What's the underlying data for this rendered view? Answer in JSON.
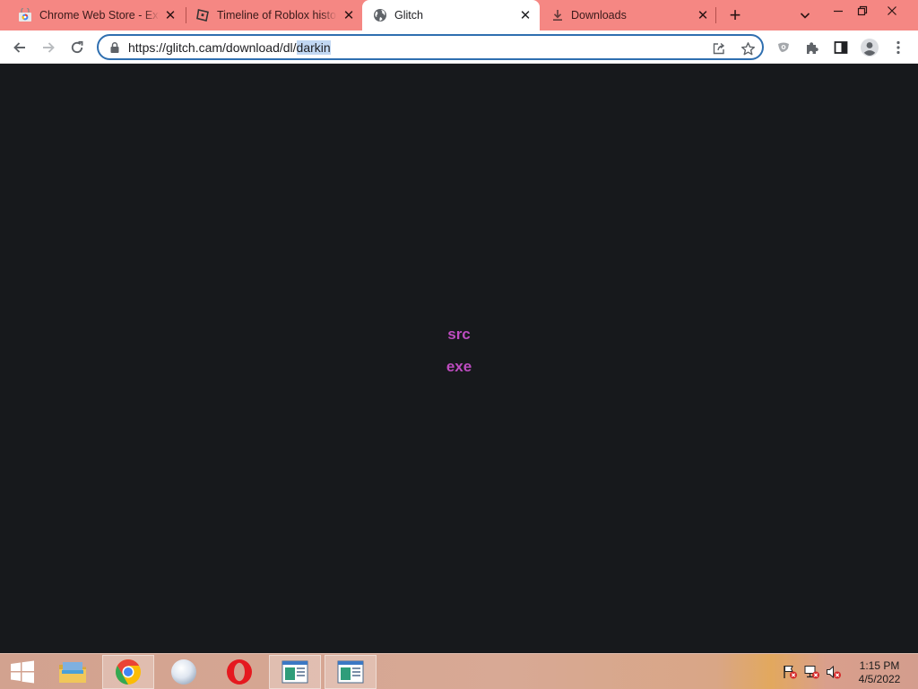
{
  "tabs": [
    {
      "title": "Chrome Web Store - Extensions",
      "favicon": "chrome-web-store-icon",
      "active": false
    },
    {
      "title": "Timeline of Roblox history",
      "favicon": "roblox-icon",
      "active": false
    },
    {
      "title": "Glitch",
      "favicon": "globe-icon",
      "active": true
    },
    {
      "title": "Downloads",
      "favicon": "download-icon",
      "active": false
    }
  ],
  "omnibox": {
    "url_base": "https://glitch.cam/download/dl/",
    "url_selected": "darkin"
  },
  "page": {
    "links": [
      "src",
      "exe"
    ],
    "gradient_start": "#e3449a",
    "gradient_end": "#9a55e8",
    "background": "#17191c"
  },
  "taskbar": {
    "apps": [
      "windows-start-icon",
      "file-explorer-icon",
      "chrome-icon",
      "generic-app-icon",
      "opera-icon",
      "window-app-icon",
      "window-app-icon"
    ],
    "clock_time": "1:15 PM",
    "clock_date": "4/5/2022"
  },
  "colors": {
    "tabstrip": "#f58783",
    "omnibox_border": "#2f6fb0"
  }
}
